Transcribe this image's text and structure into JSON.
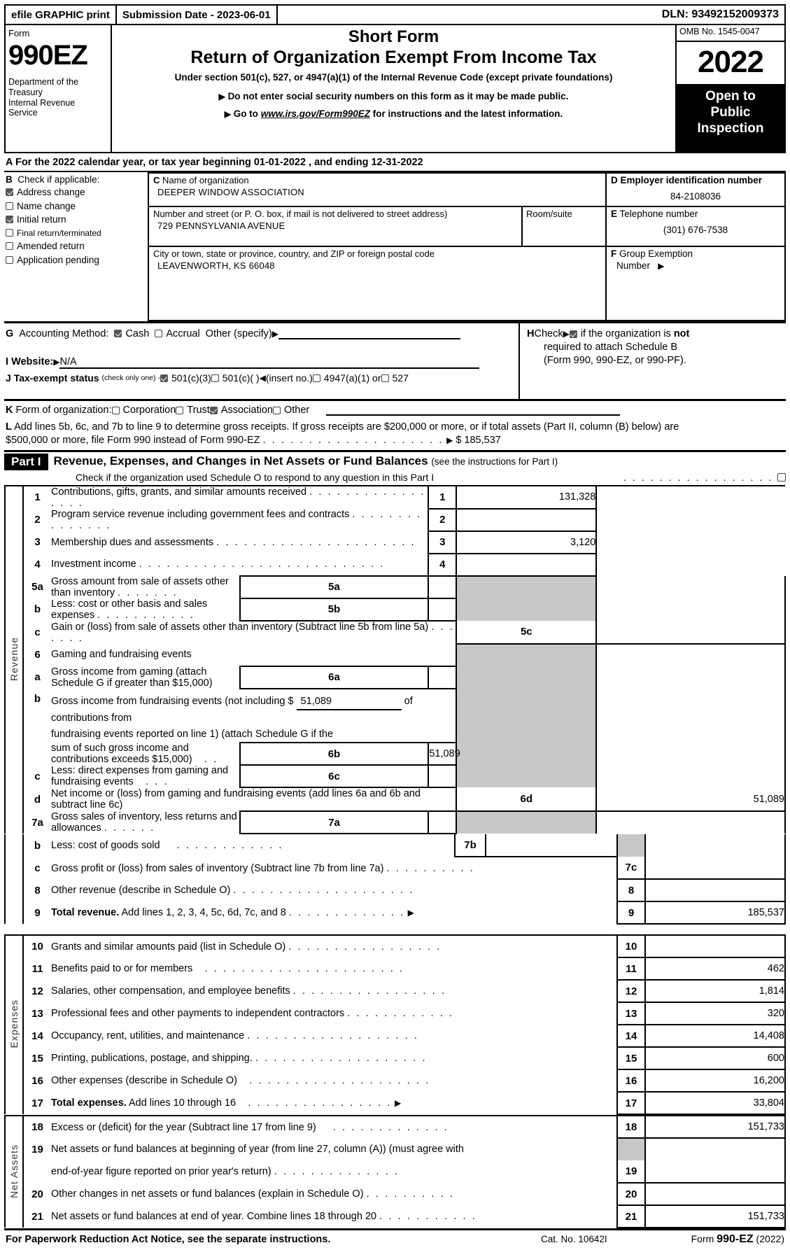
{
  "efile": {
    "graphic_print": "efile GRAPHIC print",
    "submission_date": "Submission Date - 2023-06-01",
    "dln": "DLN: 93492152009373"
  },
  "masthead": {
    "form_label": "Form",
    "form_number": "990EZ",
    "department": "Department of the Treasury Internal Revenue Service",
    "title_short": "Short Form",
    "title_main": "Return of Organization Exempt From Income Tax",
    "subtitle": "Under section 501(c), 527, or 4947(a)(1) of the Internal Revenue Code (except private foundations)",
    "note1": "Do not enter social security numbers on this form as it may be made public.",
    "note2_prefix": "Go to",
    "note2_link": "www.irs.gov/Form990EZ",
    "note2_suffix": "for instructions and the latest information.",
    "omb": "OMB No. 1545-0047",
    "year": "2022",
    "open_to_public": "Open to Public Inspection"
  },
  "line_a": {
    "letter": "A",
    "text": "For the 2022 calendar year, or tax year beginning 01-01-2022 , and ending 12-31-2022"
  },
  "section_b": {
    "letter": "B",
    "header": "Check if applicable:",
    "items": [
      {
        "label": "Address change",
        "checked": true
      },
      {
        "label": "Name change",
        "checked": false
      },
      {
        "label": "Initial return",
        "checked": true
      },
      {
        "label": "Final return/terminated",
        "checked": false
      },
      {
        "label": "Amended return",
        "checked": false
      },
      {
        "label": "Application pending",
        "checked": false
      }
    ]
  },
  "section_c": {
    "letter": "C",
    "name_label": "Name of organization",
    "name_value": "DEEPER WINDOW ASSOCIATION",
    "street_label": "Number and street (or P. O. box, if mail is not delivered to street address)",
    "street_value": "729 PENNSYLVANIA AVENUE",
    "room_label": "Room/suite",
    "room_value": "",
    "city_label": "City or town, state or province, country, and ZIP or foreign postal code",
    "city_value": "LEAVENWORTH, KS  66048"
  },
  "section_d": {
    "letter": "D",
    "label": "Employer identification number",
    "value": "84-2108036"
  },
  "section_e": {
    "letter": "E",
    "label": "Telephone number",
    "value": "(301) 676-7538"
  },
  "section_f": {
    "letter": "F",
    "label": "Group Exemption",
    "label2": "Number",
    "value": ""
  },
  "section_g": {
    "letter": "G",
    "label": "Accounting Method:",
    "cash": "Cash",
    "cash_checked": true,
    "accrual": "Accrual",
    "accrual_checked": false,
    "other": "Other (specify)",
    "other_value": ""
  },
  "section_h": {
    "letter": "H",
    "check_word": "Check",
    "checked": true,
    "text1": "if the organization is",
    "text_bold": "not",
    "text2": "required to attach Schedule B",
    "text3": "(Form 990, 990-EZ, or 990-PF)."
  },
  "section_i": {
    "letter": "I",
    "label": "Website:",
    "value": "N/A"
  },
  "section_j": {
    "letter": "J",
    "label": "Tax-exempt status",
    "note": "(check only one) -",
    "options": [
      {
        "label": "501(c)(3)",
        "checked": true
      },
      {
        "label": "501(c)(   )",
        "checked": false
      },
      {
        "label": "4947(a)(1) or",
        "checked": false
      },
      {
        "label": "527",
        "checked": false
      }
    ],
    "insert_no": "(insert no.)"
  },
  "section_k": {
    "letter": "K",
    "label": "Form of organization:",
    "options": [
      {
        "label": "Corporation",
        "checked": false
      },
      {
        "label": "Trust",
        "checked": false
      },
      {
        "label": "Association",
        "checked": true
      },
      {
        "label": "Other",
        "checked": false
      }
    ]
  },
  "section_l": {
    "letter": "L",
    "text1": "Add lines 5b, 6c, and 7b to line 9 to determine gross receipts. If gross receipts are $200,000 or more, or if total assets (Part II, column (B) below) are",
    "text2": "$500,000 or more, file Form 990 instead of Form 990-EZ",
    "amount": "$ 185,537"
  },
  "part1": {
    "tag": "Part I",
    "title": "Revenue, Expenses, and Changes in Net Assets or Fund Balances",
    "title_note": "(see the instructions for Part I)",
    "schedule_o": "Check if the organization used Schedule O to respond to any question in this Part I",
    "schedule_o_checked": false,
    "revenue_label": "Revenue",
    "expenses_label": "Expenses",
    "net_assets_label": "Net Assets"
  },
  "lines": {
    "l1": {
      "num": "1",
      "desc": "Contributions, gifts, grants, and similar amounts received",
      "amount": "131,328"
    },
    "l2": {
      "num": "2",
      "desc": "Program service revenue including government fees and contracts",
      "amount": ""
    },
    "l3": {
      "num": "3",
      "desc": "Membership dues and assessments",
      "amount": "3,120"
    },
    "l4": {
      "num": "4",
      "desc": "Investment income",
      "amount": ""
    },
    "l5a": {
      "num": "5a",
      "inner_num": "5a",
      "desc": "Gross amount from sale of assets other than inventory",
      "inner_amount": ""
    },
    "l5b": {
      "num": "b",
      "inner_num": "5b",
      "desc": "Less: cost or other basis and sales expenses",
      "inner_amount": ""
    },
    "l5c": {
      "num": "c",
      "side_num": "5c",
      "desc": "Gain or (loss) from sale of assets other than inventory (Subtract line 5b from line 5a)",
      "amount": ""
    },
    "l6": {
      "num": "6",
      "desc": "Gaming and fundraising events"
    },
    "l6a": {
      "num": "a",
      "inner_num": "6a",
      "desc": "Gross income from gaming (attach Schedule G if greater than $15,000)",
      "inner_amount": ""
    },
    "l6b": {
      "num": "b",
      "inner_num": "6b",
      "desc_p1": "Gross income from fundraising events (not including $",
      "inline_value": "51,089",
      "desc_p2": "of contributions from",
      "desc_p3": "fundraising events reported on line 1) (attach Schedule G if the",
      "desc_p4": "sum of such gross income and contributions exceeds $15,000)",
      "inner_amount": "51,089"
    },
    "l6c": {
      "num": "c",
      "inner_num": "6c",
      "desc": "Less: direct expenses from gaming and fundraising events",
      "inner_amount": ""
    },
    "l6d": {
      "num": "d",
      "side_num": "6d",
      "desc": "Net income or (loss) from gaming and fundraising events (add lines 6a and 6b and subtract line 6c)",
      "amount": "51,089"
    },
    "l7a": {
      "num": "7a",
      "inner_num": "7a",
      "desc": "Gross sales of inventory, less returns and allowances",
      "inner_amount": ""
    },
    "l7b": {
      "num": "b",
      "inner_num": "7b",
      "desc": "Less: cost of goods sold",
      "inner_amount": ""
    },
    "l7c": {
      "num": "c",
      "side_num": "7c",
      "desc": "Gross profit or (loss) from sales of inventory (Subtract line 7b from line 7a)",
      "amount": ""
    },
    "l8": {
      "num": "8",
      "desc": "Other revenue (describe in Schedule O)",
      "amount": ""
    },
    "l9": {
      "num": "9",
      "desc_bold": "Total revenue.",
      "desc": "Add lines 1, 2, 3, 4, 5c, 6d, 7c, and 8",
      "amount": "185,537"
    },
    "l10": {
      "num": "10",
      "desc": "Grants and similar amounts paid (list in Schedule O)",
      "amount": ""
    },
    "l11": {
      "num": "11",
      "desc": "Benefits paid to or for members",
      "amount": "462"
    },
    "l12": {
      "num": "12",
      "desc": "Salaries, other compensation, and employee benefits",
      "amount": "1,814"
    },
    "l13": {
      "num": "13",
      "desc": "Professional fees and other payments to independent contractors",
      "amount": "320"
    },
    "l14": {
      "num": "14",
      "desc": "Occupancy, rent, utilities, and maintenance",
      "amount": "14,408"
    },
    "l15": {
      "num": "15",
      "desc": "Printing, publications, postage, and shipping.",
      "amount": "600"
    },
    "l16": {
      "num": "16",
      "desc": "Other expenses (describe in Schedule O)",
      "amount": "16,200"
    },
    "l17": {
      "num": "17",
      "desc_bold": "Total expenses.",
      "desc": "Add lines 10 through 16",
      "amount": "33,804"
    },
    "l18": {
      "num": "18",
      "desc": "Excess or (deficit) for the year (Subtract line 17 from line 9)",
      "amount": "151,733"
    },
    "l19": {
      "num": "19",
      "desc_p1": "Net assets or fund balances at beginning of year (from line 27, column (A)) (must agree with",
      "desc_p2": "end-of-year figure reported on prior year's return)",
      "amount": ""
    },
    "l20": {
      "num": "20",
      "desc": "Other changes in net assets or fund balances (explain in Schedule O)",
      "amount": ""
    },
    "l21": {
      "num": "21",
      "desc": "Net assets or fund balances at end of year. Combine lines 18 through 20",
      "amount": "151,733"
    }
  },
  "footer": {
    "notice": "For Paperwork Reduction Act Notice, see the separate instructions.",
    "cat_no": "Cat. No. 10642I",
    "form_prefix": "Form",
    "form_name": "990-EZ",
    "form_year": "(2022)"
  }
}
